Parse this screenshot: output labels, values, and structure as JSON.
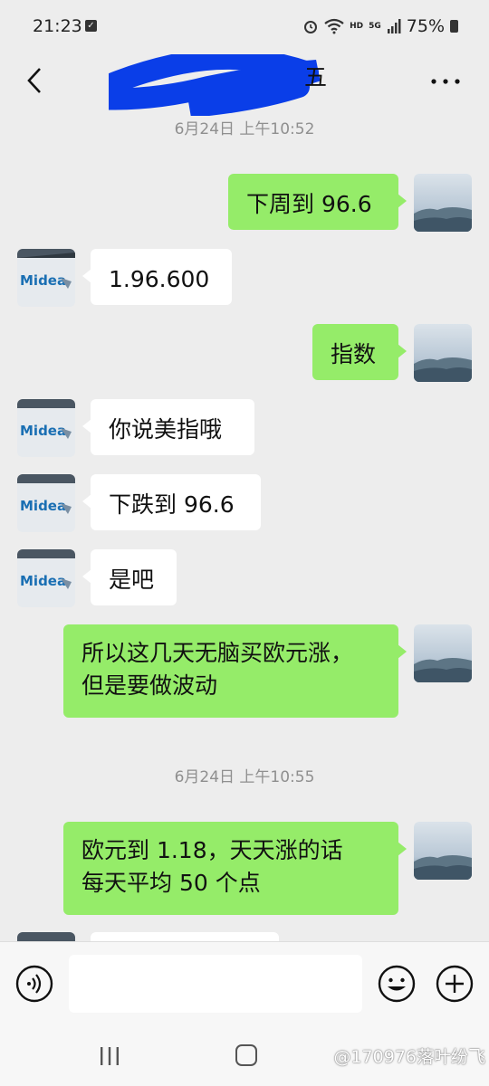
{
  "status_bar": {
    "time": "21:23",
    "net_label": "HD",
    "gen_label": "5G",
    "battery": "75%"
  },
  "header": {
    "title_fragment": "五",
    "icons": {
      "back": "chevron-left-icon",
      "more": "more-dots-icon"
    }
  },
  "messages": [
    {
      "kind": "time",
      "text": "6月24日 上午10:52"
    },
    {
      "kind": "msg",
      "from": "me",
      "text": "下周到 96.6"
    },
    {
      "kind": "msg",
      "from": "them",
      "text": "1.96.600"
    },
    {
      "kind": "msg",
      "from": "me",
      "text": "指数"
    },
    {
      "kind": "msg",
      "from": "them",
      "text": "你说美指哦"
    },
    {
      "kind": "msg",
      "from": "them",
      "text": "下跌到 96.6"
    },
    {
      "kind": "msg",
      "from": "them",
      "text": "是吧"
    },
    {
      "kind": "msg",
      "from": "me",
      "lines": [
        "所以这几天无脑买欧元涨，",
        "但是要做波动"
      ]
    },
    {
      "kind": "time",
      "text": "6月24日 上午10:55"
    },
    {
      "kind": "msg",
      "from": "me",
      "lines": [
        "欧元到 1.18，天天涨的话",
        "每天平均 50 个点"
      ]
    }
  ],
  "contact_avatar": {
    "logo_text": "Midea"
  },
  "input_bar": {
    "placeholder": "",
    "icons": {
      "voice": "voice-icon",
      "emoji": "emoji-icon",
      "plus": "plus-icon"
    }
  },
  "watermark": "@170976落叶纷飞",
  "colors": {
    "background": "#ededed",
    "my_bubble": "#95ec69",
    "their_bubble": "#ffffff",
    "time_text": "#8f8f8f",
    "redaction": "#0a3ee8"
  }
}
